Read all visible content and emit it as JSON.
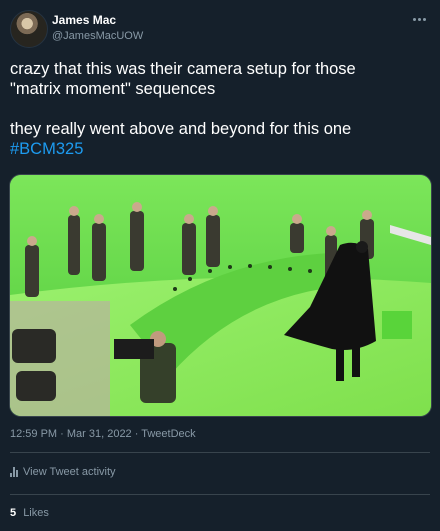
{
  "author": {
    "display_name": "James Mac",
    "handle": "@JamesMacUOW"
  },
  "tweet": {
    "line1": "crazy that this was their camera setup for those",
    "line2": "\"matrix moment\" sequences",
    "line3": "they really went above and beyond for this one",
    "hashtag": "#BCM325"
  },
  "media": {
    "description_icon": "photo",
    "accent_color": "#67e04a"
  },
  "meta": {
    "timestamp": "12:59 PM · Mar 31, 2022 · TweetDeck"
  },
  "actions": {
    "view_activity_label": "View Tweet activity"
  },
  "stats": {
    "likes_count": "5",
    "likes_label": "Likes"
  },
  "colors": {
    "background": "#15202b",
    "secondary_text": "#8899a6",
    "link": "#1d9bf0",
    "divider": "#38444d"
  }
}
